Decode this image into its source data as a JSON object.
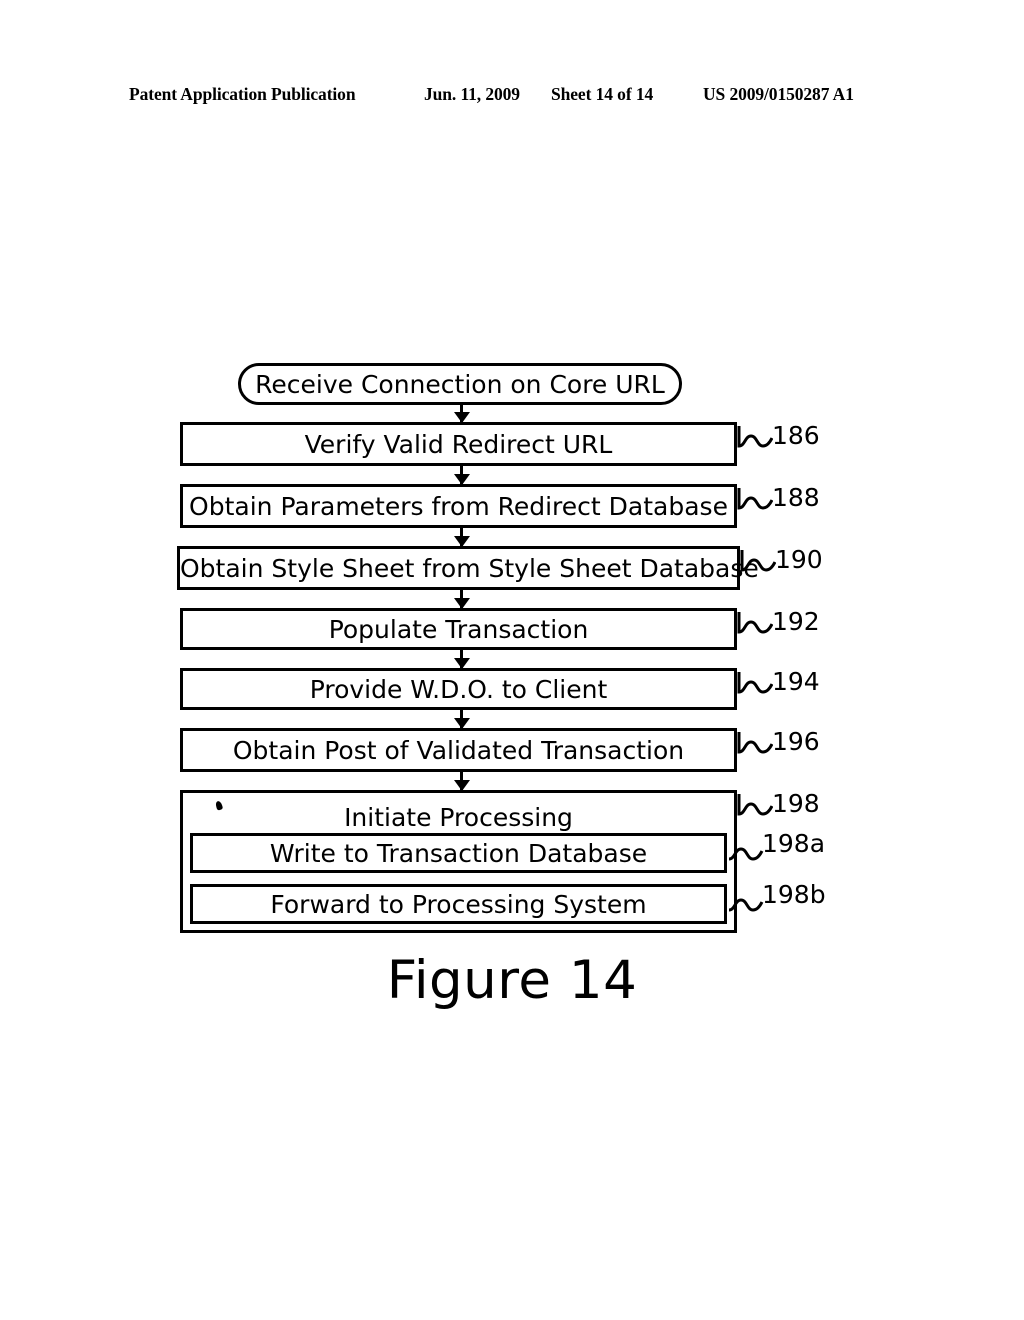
{
  "header": {
    "publication": "Patent Application Publication",
    "date": "Jun. 11, 2009",
    "sheet": "Sheet 14 of 14",
    "document_number": "US 2009/0150287 A1"
  },
  "figure": {
    "caption": "Figure 14"
  },
  "chart_data": {
    "type": "diagram",
    "diagram_type": "flowchart",
    "title": "Figure 14",
    "orientation": "top-to-bottom",
    "nodes": [
      {
        "id": "start",
        "label": "Receive Connection on Core URL",
        "shape": "terminator",
        "ref": ""
      },
      {
        "id": "n186",
        "label": "Verify Valid Redirect URL",
        "shape": "process",
        "ref": "186"
      },
      {
        "id": "n188",
        "label": "Obtain Parameters from Redirect Database",
        "shape": "process",
        "ref": "188"
      },
      {
        "id": "n190",
        "label": "Obtain Style Sheet from Style Sheet Database",
        "shape": "process",
        "ref": "190"
      },
      {
        "id": "n192",
        "label": "Populate Transaction",
        "shape": "process",
        "ref": "192"
      },
      {
        "id": "n194",
        "label": "Provide W.D.O. to Client",
        "shape": "process",
        "ref": "194"
      },
      {
        "id": "n196",
        "label": "Obtain Post of Validated Transaction",
        "shape": "process",
        "ref": "196"
      },
      {
        "id": "n198",
        "label": "Initiate Processing",
        "shape": "group",
        "ref": "198"
      },
      {
        "id": "n198a",
        "label": "Write to Transaction Database",
        "shape": "process",
        "ref": "198a",
        "parent": "n198"
      },
      {
        "id": "n198b",
        "label": "Forward to Processing System",
        "shape": "process",
        "ref": "198b",
        "parent": "n198"
      }
    ],
    "edges": [
      {
        "from": "start",
        "to": "n186",
        "type": "arrow"
      },
      {
        "from": "n186",
        "to": "n188",
        "type": "arrow"
      },
      {
        "from": "n188",
        "to": "n190",
        "type": "arrow"
      },
      {
        "from": "n190",
        "to": "n192",
        "type": "arrow"
      },
      {
        "from": "n192",
        "to": "n194",
        "type": "arrow"
      },
      {
        "from": "n194",
        "to": "n196",
        "type": "arrow"
      },
      {
        "from": "n196",
        "to": "n198",
        "type": "arrow"
      }
    ],
    "colors": {
      "stroke": "#000000",
      "fill": "#ffffff",
      "text": "#000000"
    }
  }
}
